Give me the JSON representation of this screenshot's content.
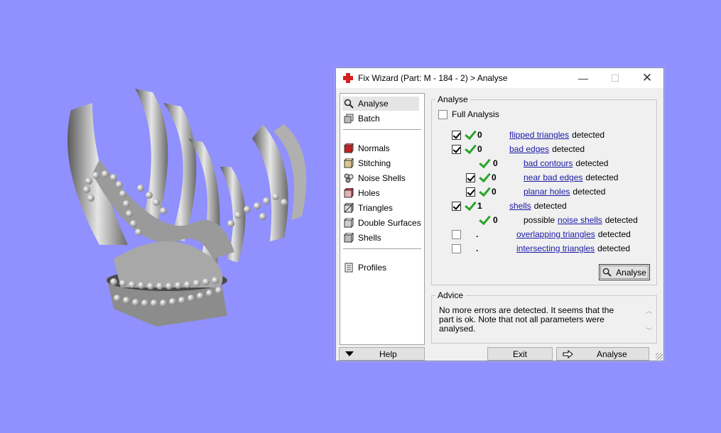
{
  "window": {
    "title": "Fix Wizard (Part: M - 184 - 2) > Analyse",
    "minimize": "—",
    "maximize": "☐",
    "close": "✕"
  },
  "sidebar": {
    "items": [
      {
        "label": "Analyse",
        "icon": "magnifier-icon",
        "selected": true
      },
      {
        "label": "Batch",
        "icon": "batch-icon"
      },
      {
        "label": "Normals",
        "icon": "normals-cube-icon"
      },
      {
        "label": "Stitching",
        "icon": "stitching-cube-icon"
      },
      {
        "label": "Noise Shells",
        "icon": "noise-shells-icon"
      },
      {
        "label": "Holes",
        "icon": "holes-cube-icon"
      },
      {
        "label": "Triangles",
        "icon": "triangles-cube-icon"
      },
      {
        "label": "Double Surfaces",
        "icon": "double-surfaces-cube-icon"
      },
      {
        "label": "Shells",
        "icon": "shells-cube-icon"
      },
      {
        "label": "Profiles",
        "icon": "profiles-icon"
      }
    ]
  },
  "analyse": {
    "group_label": "Analyse",
    "full_analysis": "Full Analysis",
    "detected": "detected",
    "rows": [
      {
        "count": "0",
        "link": "flipped triangles",
        "suffix": "detected"
      },
      {
        "count": "0",
        "link": "bad edges",
        "suffix": "detected"
      },
      {
        "count": "0",
        "link": "bad contours",
        "suffix": "detected"
      },
      {
        "count": "0",
        "link": "near bad edges",
        "suffix": "detected"
      },
      {
        "count": "0",
        "link": "planar holes",
        "suffix": "detected"
      },
      {
        "count": "1",
        "link": "shells",
        "suffix": "detected"
      },
      {
        "count": "0",
        "prefix": "possible",
        "link": "noise shells",
        "suffix": "detected"
      },
      {
        "count": ".",
        "link": "overlapping triangles",
        "suffix": "detected"
      },
      {
        "count": ".",
        "link": "intersecting triangles",
        "suffix": "detected"
      }
    ],
    "button": "Analyse"
  },
  "advice": {
    "group_label": "Advice",
    "text": "No more errors are detected. It seems that the part is ok. Note that not all parameters were analysed."
  },
  "bottom": {
    "help": "Help",
    "exit": "Exit",
    "analyse": "Analyse"
  },
  "colors": {
    "background": "#9090ff",
    "link": "#1a1aa6",
    "tick": "#2aa32a"
  }
}
